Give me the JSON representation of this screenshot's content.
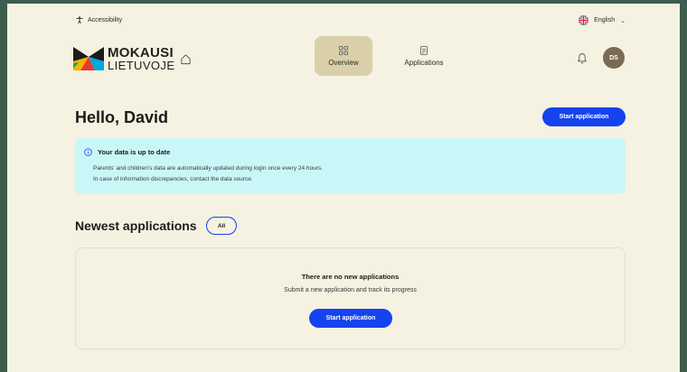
{
  "utility": {
    "accessibility_label": "Accessibility",
    "language_label": "English"
  },
  "header": {
    "logo_top": "MOKAUSI",
    "logo_bottom": "LIETUVOJE",
    "tabs": [
      {
        "label": "Overview",
        "active": true,
        "icon": "grid-icon"
      },
      {
        "label": "Applications",
        "active": false,
        "icon": "document-icon"
      }
    ],
    "avatar_initials": "DS"
  },
  "main": {
    "greeting": "Hello, David",
    "start_application_label": "Start application",
    "info": {
      "title": "Your data is up to date",
      "line1": "Parents' and children's data are automatically updated during login once every 24 hours.",
      "line2": "In case of information discrepancies, contact the data source."
    },
    "newest": {
      "title": "Newest applications",
      "all_label": "All",
      "empty_title": "There are no new applications",
      "empty_subtitle": "Submit a new application and track its progress",
      "empty_button_label": "Start application"
    }
  },
  "colors": {
    "page_background": "#f6f2e1",
    "outer_frame": "#3e5d4f",
    "accent_blue": "#1443ef",
    "active_tab": "#d9cfa9",
    "info_background": "#c9f7f7",
    "avatar_background": "#7a6a55"
  }
}
